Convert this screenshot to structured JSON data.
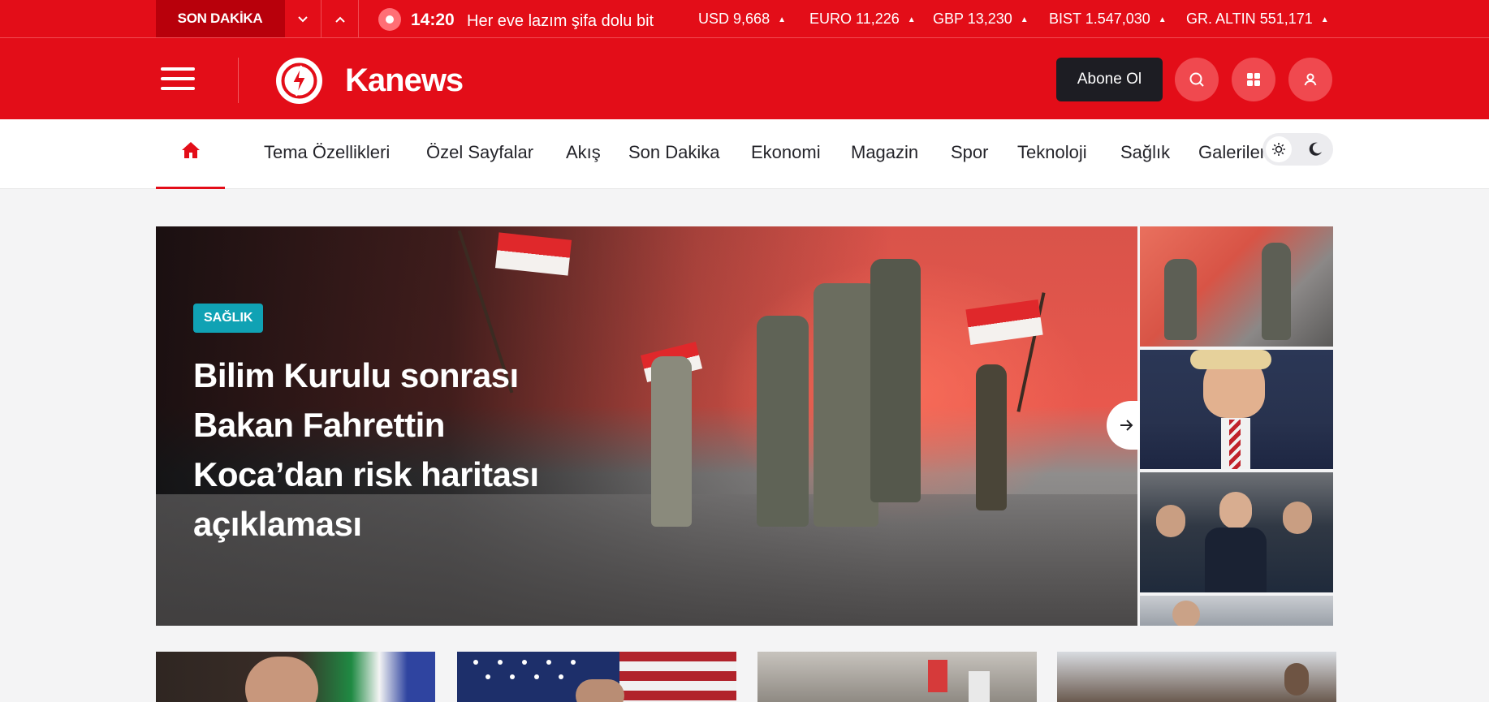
{
  "ticker": {
    "label": "SON DAKİKA",
    "time": "14:20",
    "headline": "Her eve lazım şifa dolu bit"
  },
  "markets": [
    {
      "name": "USD",
      "value": "9,668"
    },
    {
      "name": "EURO",
      "value": "11,226"
    },
    {
      "name": "GBP",
      "value": "13,230"
    },
    {
      "name": "BIST",
      "value": "1.547,030"
    },
    {
      "name": "GR. ALTIN",
      "value": "551,171"
    }
  ],
  "header": {
    "logo_text": "Kanews",
    "subscribe_label": "Abone Ol"
  },
  "nav": {
    "items": [
      "Tema Özellikleri",
      "Özel Sayfalar",
      "Akış",
      "Son Dakika",
      "Ekonomi",
      "Magazin",
      "Spor",
      "Teknoloji",
      "Sağlık",
      "Galeriler"
    ]
  },
  "hero": {
    "category": "SAĞLIK",
    "title": "Bilim Kurulu sonrası Bakan Fahrettin Koca’dan risk haritası açıklaması"
  },
  "colors": {
    "brand_red": "#e30d18",
    "dark_red": "#b8000b",
    "category_teal": "#10a2b4",
    "subscribe_bg": "#1d1d23"
  },
  "icons": {
    "ticker_down": "chevron-down-icon",
    "ticker_up": "chevron-up-icon",
    "menu": "hamburger-icon",
    "search": "search-icon",
    "apps": "grid-icon",
    "account": "user-icon",
    "home": "home-icon",
    "theme_light": "sun-icon",
    "theme_dark": "moon-icon",
    "next": "arrow-right-icon"
  }
}
